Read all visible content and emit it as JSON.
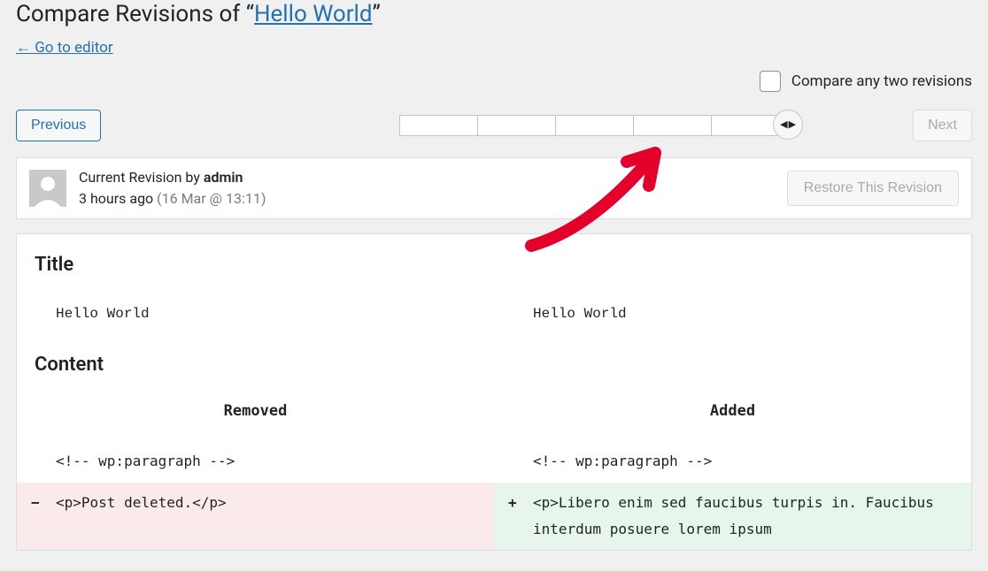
{
  "heading": {
    "prefix": "Compare Revisions of “",
    "link_text": "Hello World",
    "suffix": "”"
  },
  "back_link": "← Go to editor",
  "compare_any_label": "Compare any two revisions",
  "nav": {
    "prev": "Previous",
    "next": "Next"
  },
  "meta": {
    "byline_prefix": "Current Revision by ",
    "author": "admin",
    "ago": "3 hours ago",
    "stamp": "(16 Mar @ 13:11)",
    "restore": "Restore This Revision"
  },
  "sections": {
    "title_label": "Title",
    "content_label": "Content",
    "removed_label": "Removed",
    "added_label": "Added"
  },
  "title_diff": {
    "left": "Hello World",
    "right": "Hello World"
  },
  "content_diff": {
    "context_left": "<!-- wp:paragraph -->",
    "context_right": "<!-- wp:paragraph -->",
    "removed_line": "<p>Post deleted.</p>",
    "added_line": "<p>Libero enim sed faucibus turpis in. Faucibus interdum posuere lorem ipsum"
  },
  "signs": {
    "minus": "−",
    "plus": "+"
  },
  "slider": {
    "segments": 5
  }
}
